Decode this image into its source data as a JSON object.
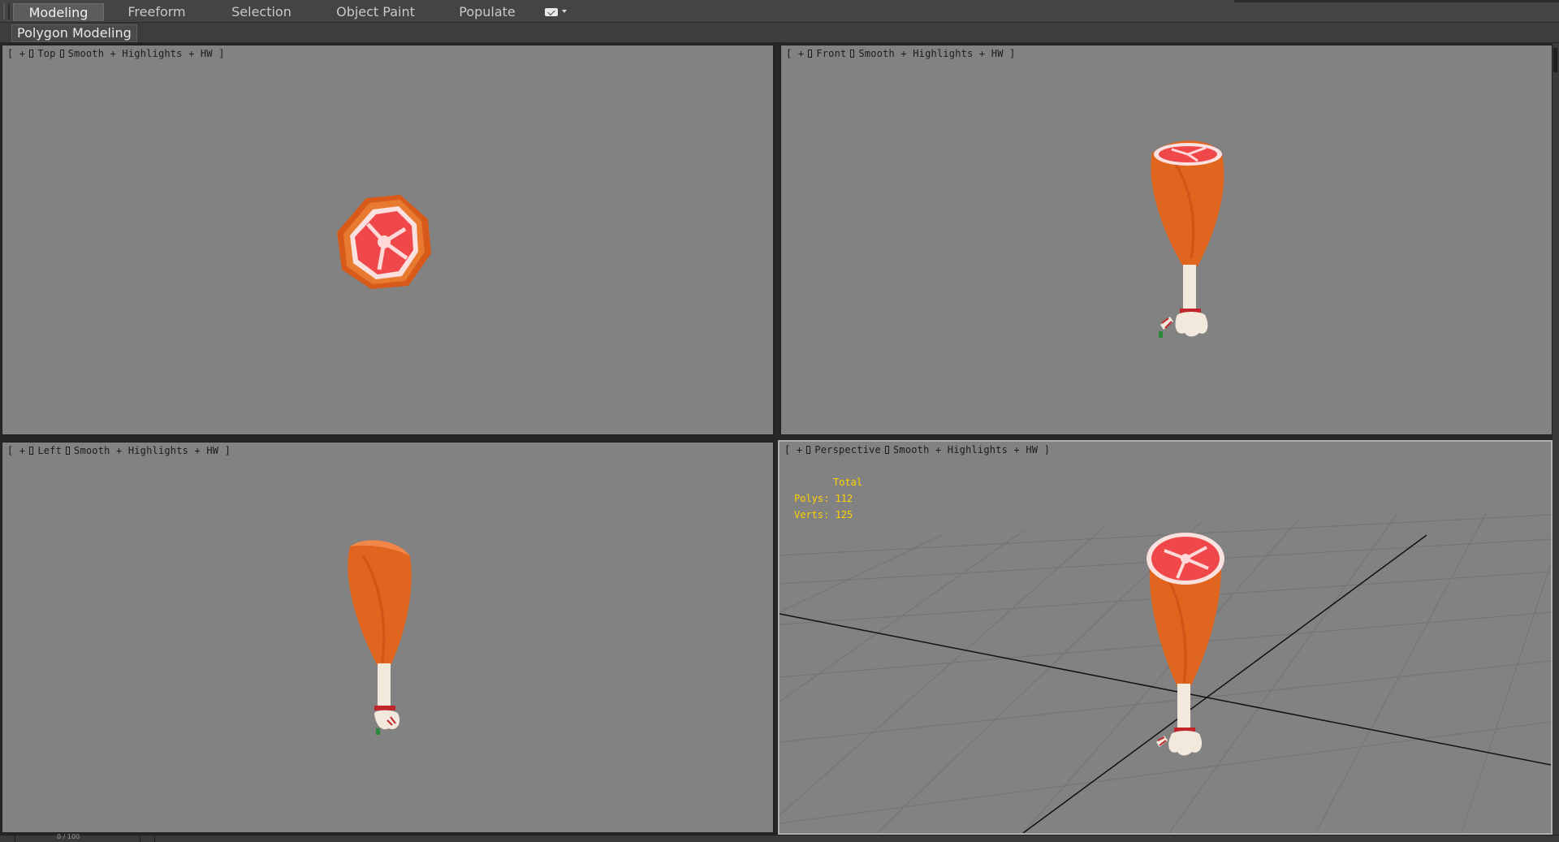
{
  "ribbon": {
    "tabs": [
      {
        "label": "Modeling",
        "active": true
      },
      {
        "label": "Freeform",
        "active": false
      },
      {
        "label": "Selection",
        "active": false
      },
      {
        "label": "Object Paint",
        "active": false
      },
      {
        "label": "Populate",
        "active": false
      }
    ],
    "extra_icon": "ribbon-options-icon",
    "panel_label": "Polygon Modeling"
  },
  "viewports": [
    {
      "id": "top",
      "menu": "+",
      "view": "Top",
      "shading": "Smooth + Highlights + HW",
      "suffix": "]",
      "prefix": "["
    },
    {
      "id": "front",
      "menu": "+",
      "view": "Front",
      "shading": "Smooth + Highlights + HW",
      "suffix": "]",
      "prefix": "["
    },
    {
      "id": "left",
      "menu": "+",
      "view": "Left",
      "shading": "Smooth + Highlights + HW",
      "suffix": "]",
      "prefix": "["
    },
    {
      "id": "perspective",
      "menu": "+",
      "view": "Perspective",
      "shading": "Smooth + Highlights + HW",
      "suffix": "]",
      "prefix": "["
    }
  ],
  "stats": {
    "title": "Total",
    "polys": "Polys: 112",
    "verts": "Verts: 125"
  },
  "status": {
    "text": "0 / 100"
  },
  "colors": {
    "viewport_bg": "#828282",
    "meat_orange": "#e0651e",
    "meat_red": "#f0474a",
    "bone": "#f2e8dc",
    "stats_yellow": "#ffd200"
  }
}
